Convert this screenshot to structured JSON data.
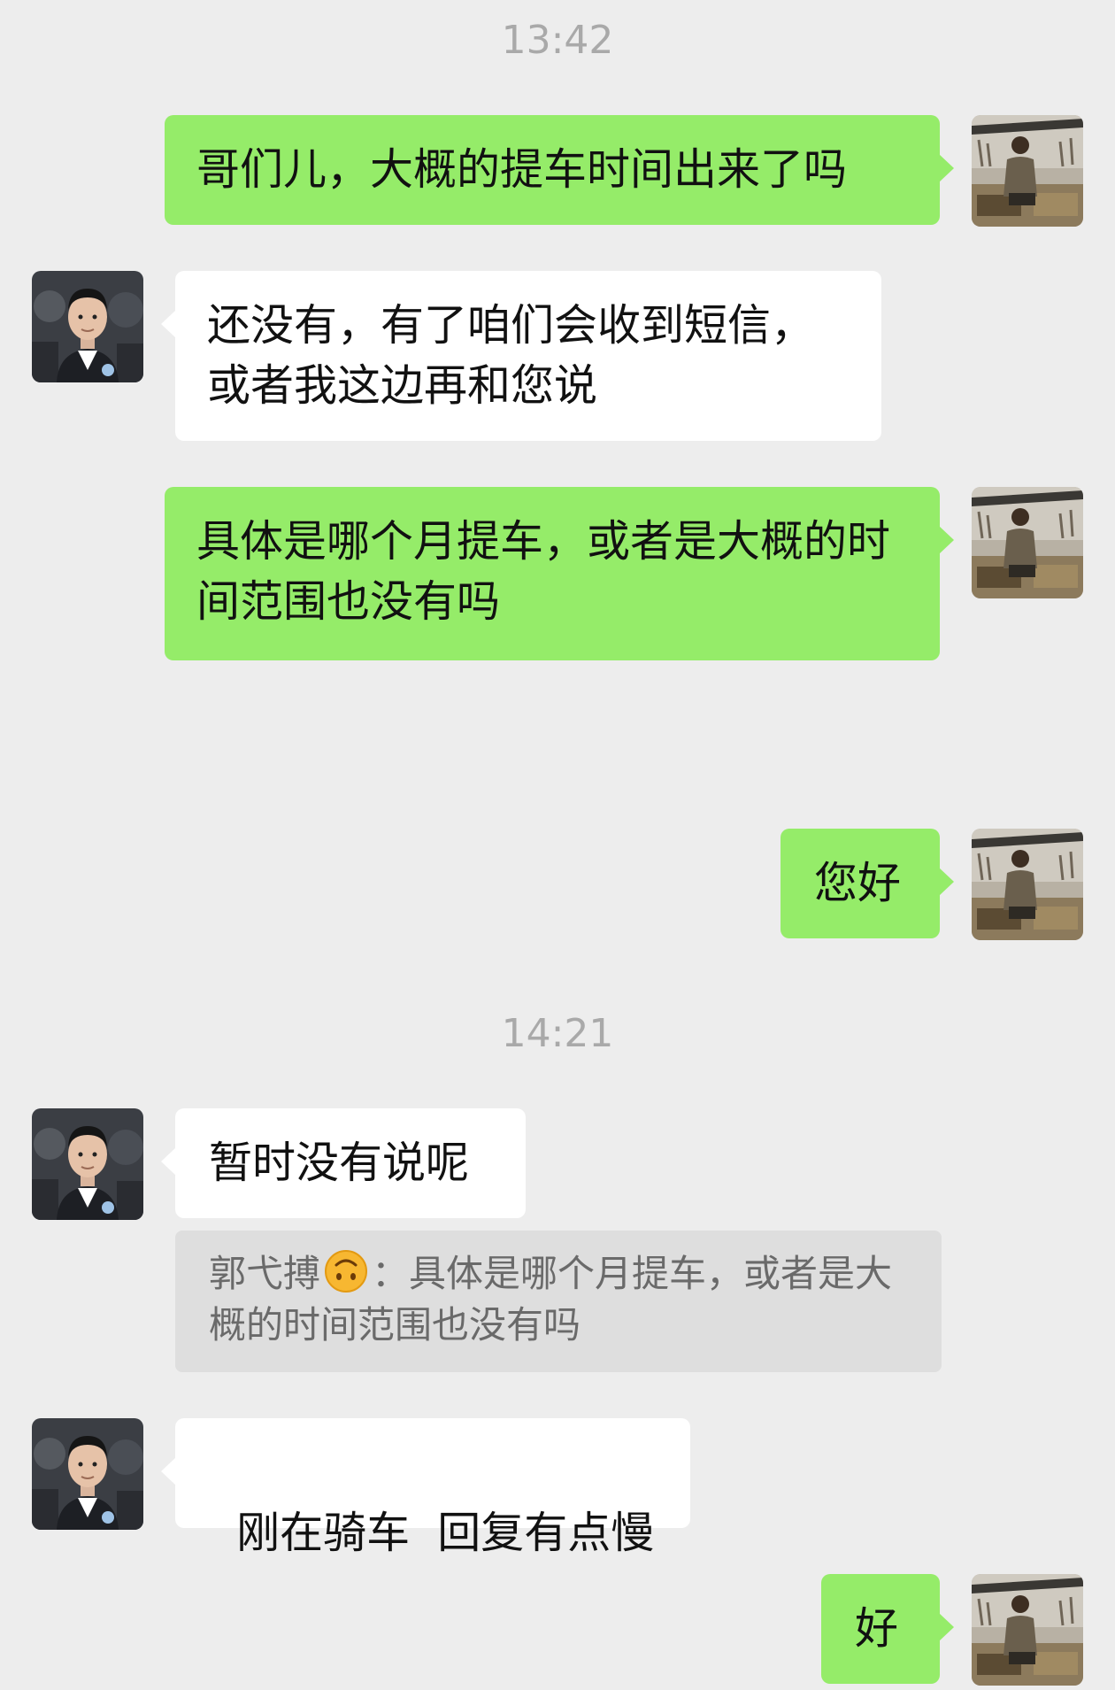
{
  "chat": {
    "time_1": "13:42",
    "time_2": "14:21",
    "msg_1": "哥们儿，大概的提车时间出来了吗",
    "msg_2": "还没有，有了咱们会收到短信，或者我这边再和您说",
    "msg_3": "具体是哪个月提车，或者是大概的时间范围也没有吗",
    "msg_4": "您好",
    "msg_5": "暂时没有说呢",
    "quote": {
      "author": "郭弋搏",
      "emoji": "upside-down-face-emoji",
      "separator": "：",
      "text": "具体是哪个月提车，或者是大概的时间范围也没有吗"
    },
    "msg_6": "刚在骑车  回复有点慢",
    "msg_7": "好"
  },
  "colors": {
    "my_bubble": "#95ec69",
    "other_bubble": "#ffffff",
    "background": "#ededed",
    "quote_background": "#dedede"
  },
  "avatars": {
    "me": "avatar-outdoor-person",
    "other": "avatar-man-portrait"
  }
}
